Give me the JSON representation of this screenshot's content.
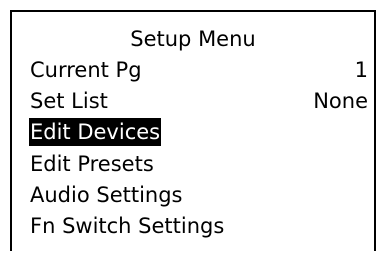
{
  "menu": {
    "title": "Setup Menu",
    "selected_index": 2,
    "items": [
      {
        "label": "Current Pg",
        "value": "1"
      },
      {
        "label": "Set List",
        "value": "None"
      },
      {
        "label": "Edit Devices",
        "value": ""
      },
      {
        "label": "Edit Presets",
        "value": ""
      },
      {
        "label": "Audio Settings",
        "value": ""
      },
      {
        "label": "Fn Switch Settings",
        "value": ""
      }
    ]
  },
  "colors": {
    "background": "#ffffff",
    "foreground": "#000000",
    "highlight_bg": "#000000",
    "highlight_fg": "#ffffff"
  }
}
